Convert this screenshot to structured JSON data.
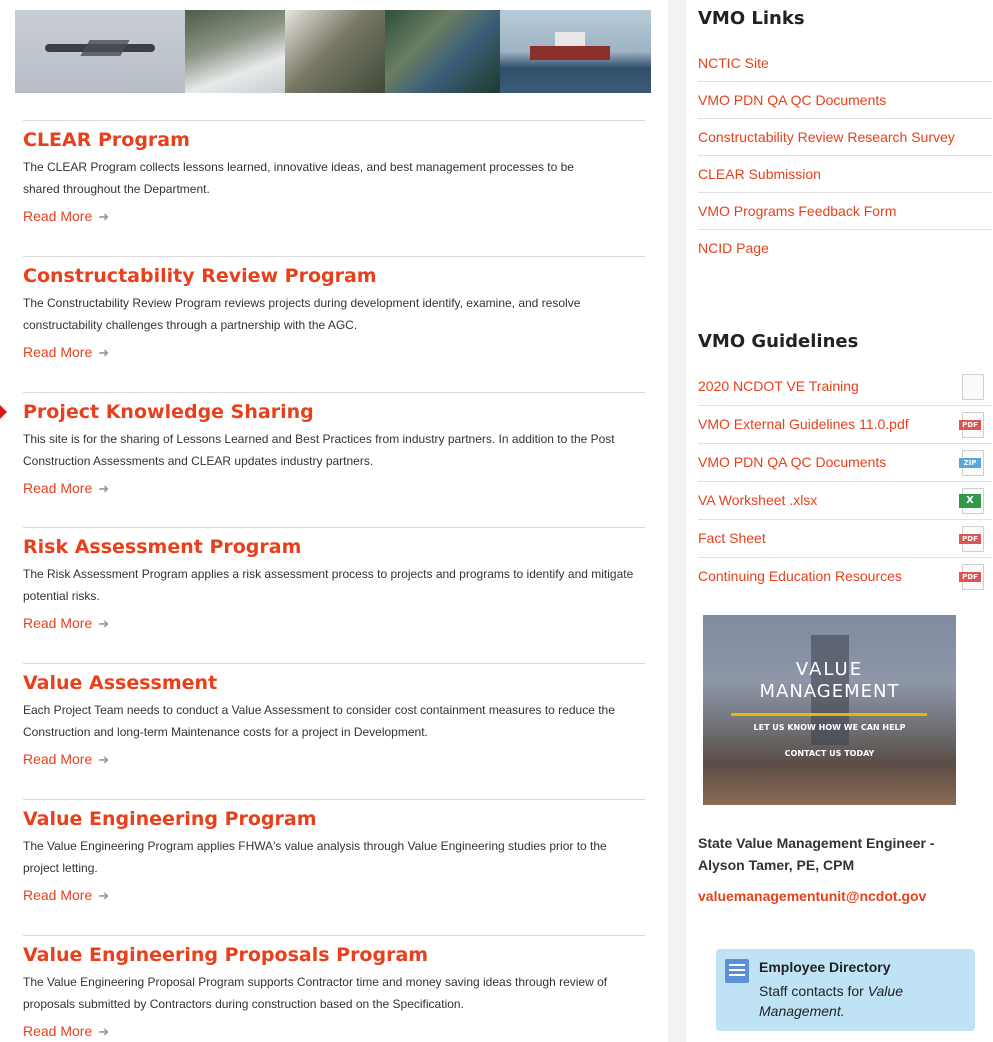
{
  "programs": [
    {
      "title": "CLEAR Program",
      "description": "The CLEAR Program collects lessons learned, innovative ideas, and best management processes to be shared throughout the Department.",
      "read_more": "Read More"
    },
    {
      "title": "Constructability Review Program",
      "description": "The Constructability Review Program reviews projects during development identify, examine, and resolve constructability challenges through a partnership with the AGC.",
      "read_more": "Read More"
    },
    {
      "title": "Project Knowledge Sharing",
      "description": "This site is for the sharing of Lessons Learned and Best Practices from industry partners. In addition to the Post Construction Assessments and CLEAR updates industry partners.",
      "read_more": "Read More"
    },
    {
      "title": "Risk Assessment Program",
      "description": "The Risk Assessment Program applies a risk assessment process to projects and programs to identify and mitigate potential risks.",
      "read_more": "Read More"
    },
    {
      "title": "Value Assessment",
      "description": "Each Project Team needs to conduct a Value Assessment to consider cost containment measures to reduce the Construction and long-term Maintenance costs for a project in Development.",
      "read_more": "Read More"
    },
    {
      "title": "Value Engineering Program",
      "description": "The Value Engineering Program applies FHWA's value analysis through Value Engineering studies prior to the project letting.",
      "read_more": "Read More"
    },
    {
      "title": "Value Engineering Proposals Program",
      "description": "The Value Engineering Proposal Program supports Contractor time and money saving ideas through review of proposals submitted by Contractors during construction based on the Specification.",
      "read_more": "Read More"
    }
  ],
  "sidebar": {
    "links_title": "VMO Links",
    "links": [
      "NCTIC Site",
      "VMO PDN QA QC Documents",
      "Constructability Review Research Survey",
      "CLEAR Submission",
      "VMO Programs Feedback Form",
      "NCID Page"
    ],
    "guidelines_title": "VMO Guidelines",
    "guidelines": [
      {
        "label": "2020 NCDOT VE Training",
        "file_icon": "blank-file-icon",
        "tag": ""
      },
      {
        "label": "VMO External Guidelines 11.0.pdf",
        "file_icon": "pdf-file-icon",
        "tag": "PDF"
      },
      {
        "label": "VMO PDN QA QC Documents",
        "file_icon": "zip-file-icon",
        "tag": "ZIP"
      },
      {
        "label": "VA Worksheet .xlsx",
        "file_icon": "excel-file-icon",
        "tag": "X"
      },
      {
        "label": "Fact Sheet",
        "file_icon": "pdf-file-icon",
        "tag": "PDF"
      },
      {
        "label": "Continuing Education Resources",
        "file_icon": "pdf-file-icon",
        "tag": "PDF"
      }
    ],
    "promo": {
      "line1": "VALUE",
      "line2": "MANAGEMENT",
      "line3": "LET US KNOW HOW WE CAN HELP",
      "line4": "CONTACT US TODAY"
    },
    "engineer_title": "State Value Management Engineer -",
    "engineer_name": "Alyson Tamer, PE, CPM",
    "email": "valuemanagementunit@ncdot.gov",
    "directory": {
      "title": "Employee Directory",
      "desc_prefix": "Staff contacts for ",
      "desc_emph": "Value Management."
    }
  },
  "colors": {
    "accent": "#e8401c",
    "directory_bg": "#bfe3f5"
  }
}
